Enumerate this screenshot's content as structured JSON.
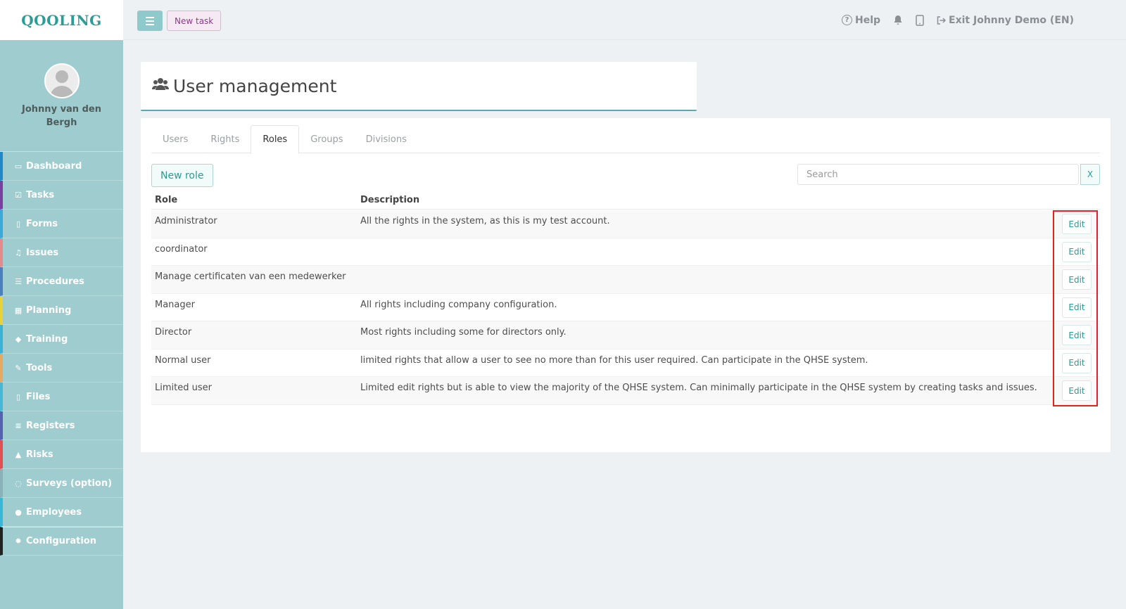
{
  "brand": {
    "logo_text": "QOOLING"
  },
  "profile": {
    "name": "Johnny van den Bergh"
  },
  "sidebar": {
    "items": [
      {
        "label": "Dashboard",
        "icon": "monitor-icon",
        "color": "#1e88c8"
      },
      {
        "label": "Tasks",
        "icon": "check-square-icon",
        "color": "#7a3fa0"
      },
      {
        "label": "Forms",
        "icon": "file-icon",
        "color": "#3aa8d8"
      },
      {
        "label": "Issues",
        "icon": "bell-icon",
        "color": "#e58a8a"
      },
      {
        "label": "Procedures",
        "icon": "list-icon",
        "color": "#4a7fc0"
      },
      {
        "label": "Planning",
        "icon": "calendar-icon",
        "color": "#e8d23a"
      },
      {
        "label": "Training",
        "icon": "graduation-cap-icon",
        "color": "#38b3d8"
      },
      {
        "label": "Tools",
        "icon": "wrench-icon",
        "color": "#e8a860"
      },
      {
        "label": "Files",
        "icon": "document-icon",
        "color": "#48b8d8"
      },
      {
        "label": "Registers",
        "icon": "bars-icon",
        "color": "#5560b0"
      },
      {
        "label": "Risks",
        "icon": "warning-icon",
        "color": "#e05050"
      },
      {
        "label": "Surveys (option)",
        "icon": "chat-icon",
        "color": "#8ab0b8"
      },
      {
        "label": "Employees",
        "icon": "users-icon",
        "color": "#38b8d8"
      },
      {
        "label": "Configuration",
        "icon": "gear-icon",
        "color": "#222222"
      }
    ]
  },
  "topbar": {
    "new_task_label": "New task",
    "help_label": "Help",
    "exit_label": "Exit Johnny Demo (EN)"
  },
  "page": {
    "title": "User management"
  },
  "tabs": [
    "Users",
    "Rights",
    "Roles",
    "Groups",
    "Divisions"
  ],
  "active_tab": "Roles",
  "toolbar": {
    "new_role_label": "New role",
    "search_placeholder": "Search",
    "clear_label": "X"
  },
  "table": {
    "headers": {
      "role": "Role",
      "description": "Description"
    },
    "edit_label": "Edit",
    "rows": [
      {
        "role": "Administrator",
        "description": "All the rights in the system, as this is my test account."
      },
      {
        "role": "coordinator",
        "description": ""
      },
      {
        "role": "Manage certificaten van een medewerker",
        "description": ""
      },
      {
        "role": "Manager",
        "description": "All rights including company configuration."
      },
      {
        "role": "Director",
        "description": "Most rights including some for directors only."
      },
      {
        "role": "Normal user",
        "description": "limited rights that allow a user to see no more than for this user required. Can participate in the QHSE system."
      },
      {
        "role": "Limited user",
        "description": "Limited edit rights but is able to view the majority of the QHSE system. Can minimally participate in the QHSE system by creating tasks and issues."
      }
    ]
  },
  "colors": {
    "accent": "#2a9b95",
    "sidebar_bg": "#9fcdcf",
    "highlight": "#e02424"
  }
}
